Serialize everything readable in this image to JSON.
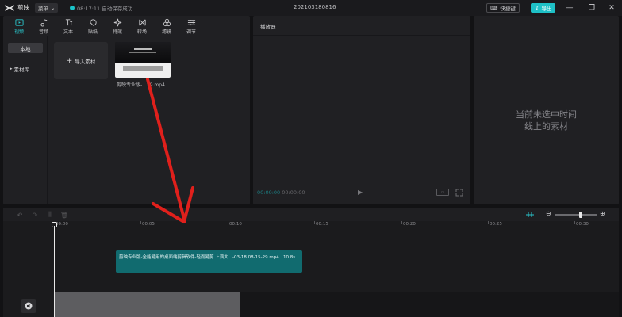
{
  "titlebar": {
    "app_name": "剪映",
    "menu_label": "菜单",
    "autosave_text": "08:17:11 自动保存成功",
    "project_name": "202103180816",
    "shortcut_label": "快捷键",
    "export_label": "导出"
  },
  "toolbar": {
    "tools": [
      {
        "label": "视频",
        "icon": "video-icon",
        "active": true
      },
      {
        "label": "音频",
        "icon": "audio-icon",
        "active": false
      },
      {
        "label": "文本",
        "icon": "text-icon",
        "active": false
      },
      {
        "label": "贴纸",
        "icon": "sticker-icon",
        "active": false
      },
      {
        "label": "特效",
        "icon": "effects-icon",
        "active": false
      },
      {
        "label": "转场",
        "icon": "transition-icon",
        "active": false
      },
      {
        "label": "滤镜",
        "icon": "filter-icon",
        "active": false
      },
      {
        "label": "调节",
        "icon": "adjust-icon",
        "active": false
      }
    ]
  },
  "media": {
    "nav": [
      {
        "label": "本地",
        "active": true
      },
      {
        "label": "素材库",
        "active": false
      }
    ],
    "import_label": "导入素材",
    "clip_thumb_label": "剪映专业版-...29.mp4"
  },
  "player": {
    "title": "播放器",
    "current_time": "00:00:00",
    "total_time": "00:00:00"
  },
  "properties": {
    "empty_line1": "当前未选中时间",
    "empty_line2": "线上的素材"
  },
  "timeline": {
    "ruler_labels": [
      "00:00",
      "00:05",
      "00:10",
      "00:15",
      "00:20",
      "00:25",
      "00:30"
    ],
    "clip_title": "剪映专业版-全能易用的桌面端剪辑软件-轻而易剪 上演大...-03-18 08-15-29.mp4",
    "clip_duration": "10.8s"
  },
  "colors": {
    "accent": "#1ec0c6",
    "clip": "#116b6f",
    "annotation": "#e0201c"
  }
}
